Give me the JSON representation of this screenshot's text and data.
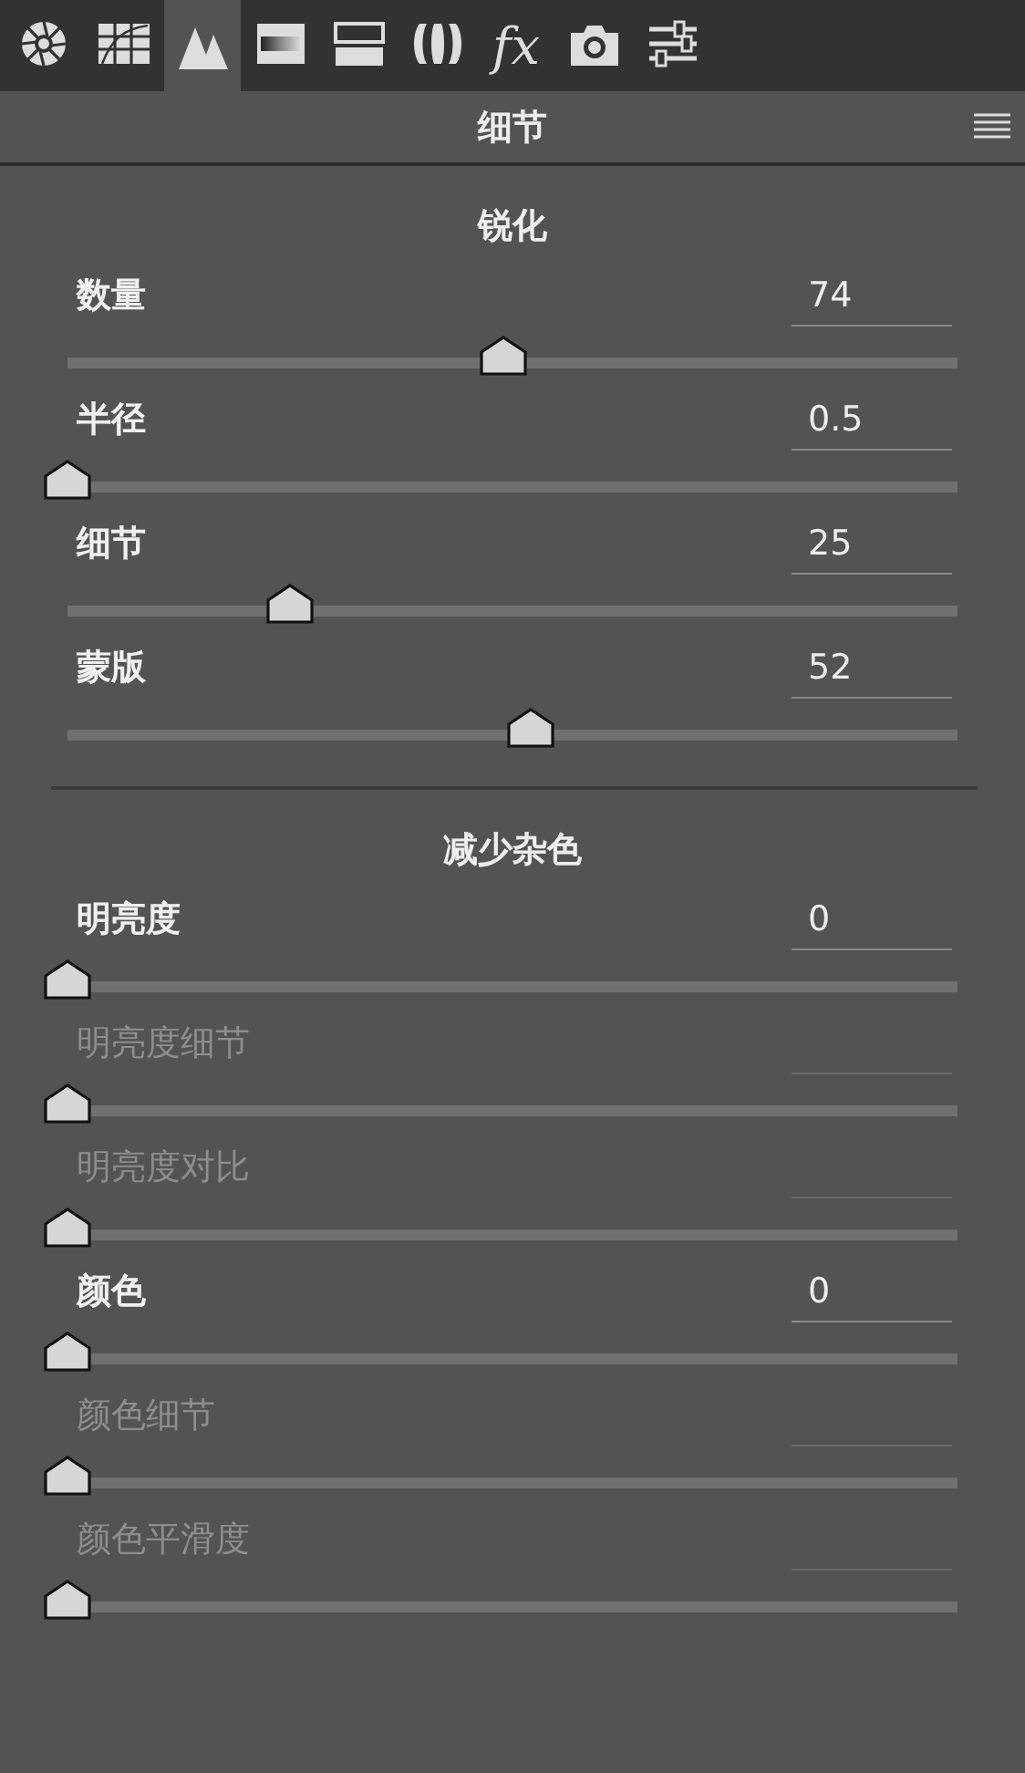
{
  "tabs": [
    {
      "selected": false
    },
    {
      "selected": false
    },
    {
      "selected": true
    },
    {
      "selected": false
    },
    {
      "selected": false
    },
    {
      "selected": false
    },
    {
      "selected": false,
      "label": "fx"
    },
    {
      "selected": false
    },
    {
      "selected": false
    }
  ],
  "panel": {
    "title": "细节"
  },
  "sections": [
    {
      "title": "锐化",
      "sliders": [
        {
          "label": "数量",
          "value": "74",
          "level": 0.49,
          "disabled": false
        },
        {
          "label": "半径",
          "value": "0.5",
          "level": 0,
          "disabled": false
        },
        {
          "label": "细节",
          "value": "25",
          "level": 0.25,
          "disabled": false
        },
        {
          "label": "蒙版",
          "value": "52",
          "level": 0.52,
          "disabled": false
        }
      ]
    },
    {
      "title": "减少杂色",
      "sliders": [
        {
          "label": "明亮度",
          "value": "0",
          "level": 0,
          "disabled": false
        },
        {
          "label": "明亮度细节",
          "level": 0,
          "disabled": true
        },
        {
          "label": "明亮度对比",
          "level": 0,
          "disabled": true
        },
        {
          "label": "颜色",
          "value": "0",
          "level": 0,
          "disabled": false
        },
        {
          "label": "颜色细节",
          "level": 0,
          "disabled": true
        },
        {
          "label": "颜色平滑度",
          "level": 0,
          "disabled": true
        }
      ]
    }
  ]
}
